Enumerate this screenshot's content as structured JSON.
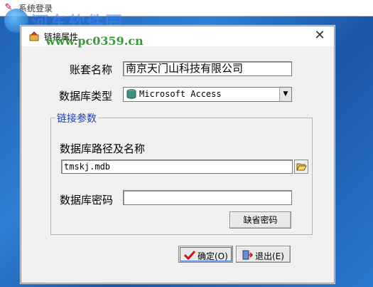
{
  "background_app": {
    "title": "系统登录",
    "watermark_title": "河东软件园",
    "watermark_url": "www.pc0359.cn"
  },
  "dialog": {
    "title": "链接属性",
    "close_glyph": "✕",
    "account_label": "账套名称",
    "account_value": "南京天门山科技有限公司",
    "dbtype_label": "数据库类型",
    "dbtype_value": "Microsoft Access",
    "group_title": "链接参数",
    "dbpath_label": "数据库路径及名称",
    "dbpath_value": "tmskj.mdb",
    "dbpassword_label": "数据库密码",
    "dbpassword_value": "",
    "default_password_button": "缺省密码",
    "ok_button": "确定(O)",
    "exit_button": "退出(E)"
  },
  "icons": {
    "app": "app-icon",
    "dialog": "dialog-icon",
    "database": "database-icon",
    "folder": "folder-open-icon",
    "check": "check-icon",
    "exit": "exit-door-icon"
  },
  "colors": {
    "desktop": "#2a72c8",
    "dialog_bg": "#f0f0f0",
    "group_title": "#1f3fb0",
    "check": "#c0161d"
  }
}
